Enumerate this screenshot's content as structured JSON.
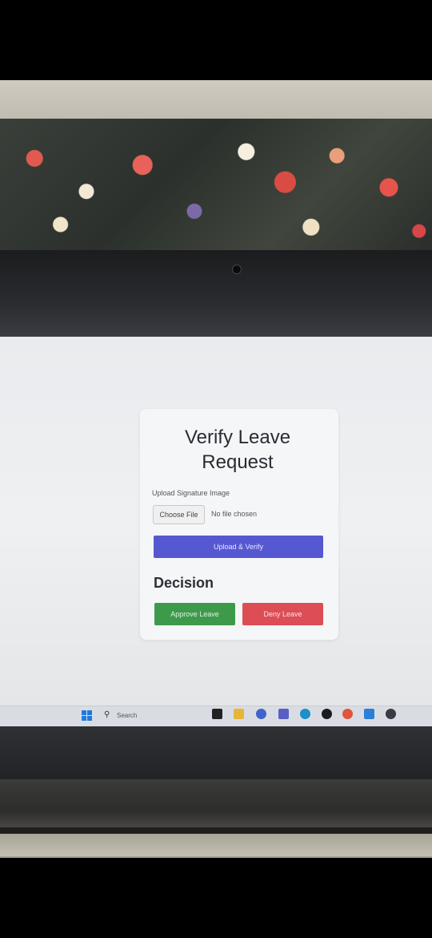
{
  "form": {
    "title_line1": "Verify Leave",
    "title_line2": "Request",
    "upload_label": "Upload Signature Image",
    "choose_file_label": "Choose File",
    "no_file_text": "No file chosen",
    "upload_verify_label": "Upload & Verify"
  },
  "decision": {
    "heading": "Decision",
    "approve_label": "Approve Leave",
    "deny_label": "Deny Leave"
  },
  "taskbar": {
    "search_placeholder": "Search",
    "apps": [
      "file-explorer-icon",
      "folder-icon",
      "chrome-icon",
      "teams-icon",
      "edge-icon",
      "media-icon",
      "chrome-icon",
      "vscode-icon",
      "browser-icon"
    ]
  },
  "colors": {
    "verify_button": "#5558d0",
    "approve_button": "#3d9a4b",
    "deny_button": "#dd4d56"
  }
}
